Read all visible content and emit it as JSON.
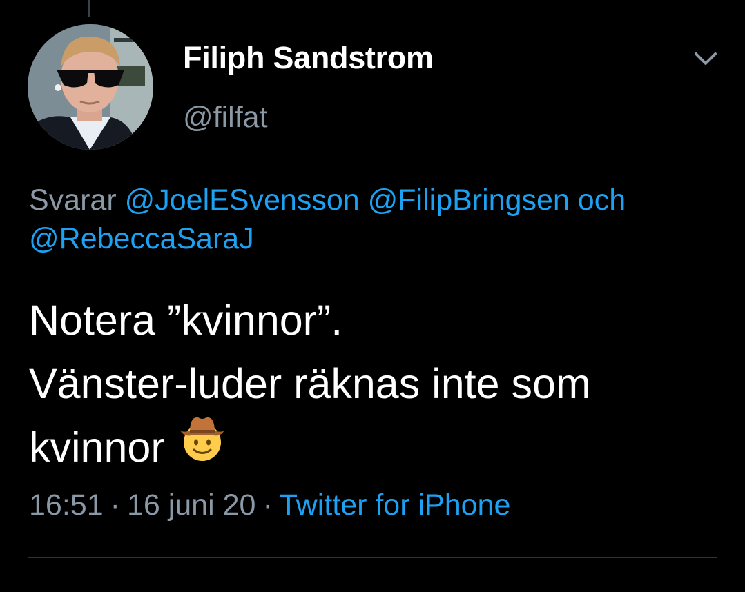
{
  "tweet": {
    "author": {
      "display_name": "Filiph Sandstrom",
      "handle": "@filfat"
    },
    "reply_to": {
      "prefix": "Svarar",
      "mentions": [
        "@JoelESvensson",
        "@FilipBringsen",
        "@RebeccaSaraJ"
      ],
      "conjunction": "och"
    },
    "text_lines": [
      "Notera ”kvinnor”.",
      "Vänster-luder räknas inte som",
      "kvinnor"
    ],
    "emoji": "cowboy-hat-face-emoji",
    "meta": {
      "time": "16:51",
      "separator": "·",
      "date": "16 juni 20",
      "source": "Twitter for iPhone"
    }
  },
  "icons": {
    "more": "chevron-down-icon"
  },
  "colors": {
    "background": "#000000",
    "text": "#ffffff",
    "secondary_text": "#8b98a5",
    "link": "#1da1f2",
    "divider": "#2f3336"
  }
}
